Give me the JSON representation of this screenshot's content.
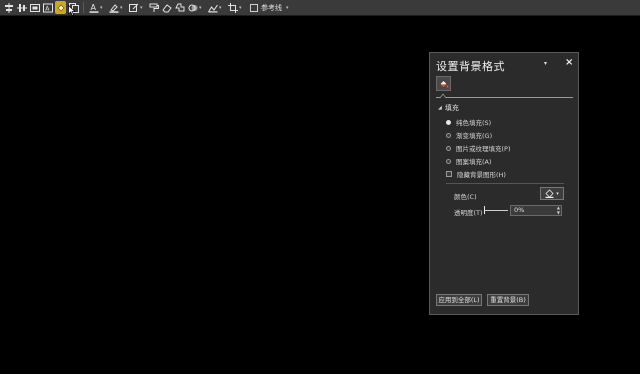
{
  "toolbar": {
    "icons": [
      "align-center-horizontal-icon",
      "align-center-vertical-icon",
      "frame-icon",
      "text-box-icon",
      "paint-bucket-icon",
      "copy-icon",
      "font-color-icon",
      "highlighter-icon",
      "edit-shape-icon",
      "format-painter-icon",
      "eraser-icon",
      "shapes-icon",
      "effects-icon",
      "arrange-icon",
      "crop-icon"
    ],
    "guides_label": "参考线"
  },
  "panel": {
    "title": "设置背景格式",
    "menu_glyph": "▾",
    "close_glyph": "×",
    "section_label": "填充",
    "fill_options": [
      {
        "label": "纯色填充(S)",
        "selected": true
      },
      {
        "label": "渐变填充(G)",
        "selected": false
      },
      {
        "label": "图片或纹理填充(P)",
        "selected": false
      },
      {
        "label": "图案填充(A)",
        "selected": false
      }
    ],
    "hide_graphics_label": "隐藏背景图形(H)",
    "color_label": "颜色(C)",
    "transparency_label": "透明度(T)",
    "transparency_value": "0%",
    "apply_all_label": "应用到全部(L)",
    "reset_label": "重置背景(B)"
  },
  "colors": {
    "background": "#000000",
    "panel": "#2b2b2b",
    "toolbar": "#3a3a3a",
    "fill_accent": "#d9582b"
  }
}
